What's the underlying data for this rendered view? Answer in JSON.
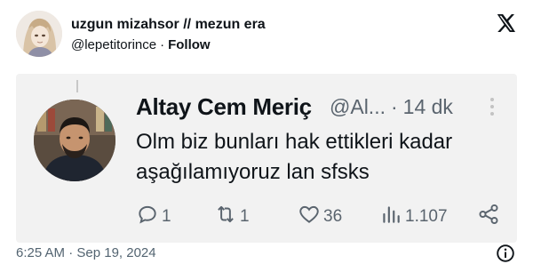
{
  "outer_tweet": {
    "author_name": "uzgun mizahsor // mezun era",
    "handle": "@lepetitorince",
    "separator": "·",
    "follow_label": "Follow",
    "timestamp": "6:25 AM · Sep 19, 2024",
    "icons": {
      "brand": "x-logo-icon",
      "info": "info-icon"
    }
  },
  "quoted_screenshot": {
    "author_name": "Altay Cem Meriç",
    "handle": "@Al...",
    "separator": "·",
    "time": "14 dk",
    "text": "Olm biz bunları hak ettikleri kadar aşağılamıyoruz lan sfsks",
    "actions": {
      "reply_count": "1",
      "retweet_count": "1",
      "like_count": "36",
      "views_count": "1.107"
    },
    "icons": {
      "reply": "reply-icon",
      "retweet": "retweet-icon",
      "like": "heart-icon",
      "views": "views-icon",
      "share": "share-icon",
      "more": "more-icon"
    }
  },
  "colors": {
    "text": "#0f1419",
    "muted": "#536471",
    "screenshot_bg": "#f2f2f2"
  }
}
